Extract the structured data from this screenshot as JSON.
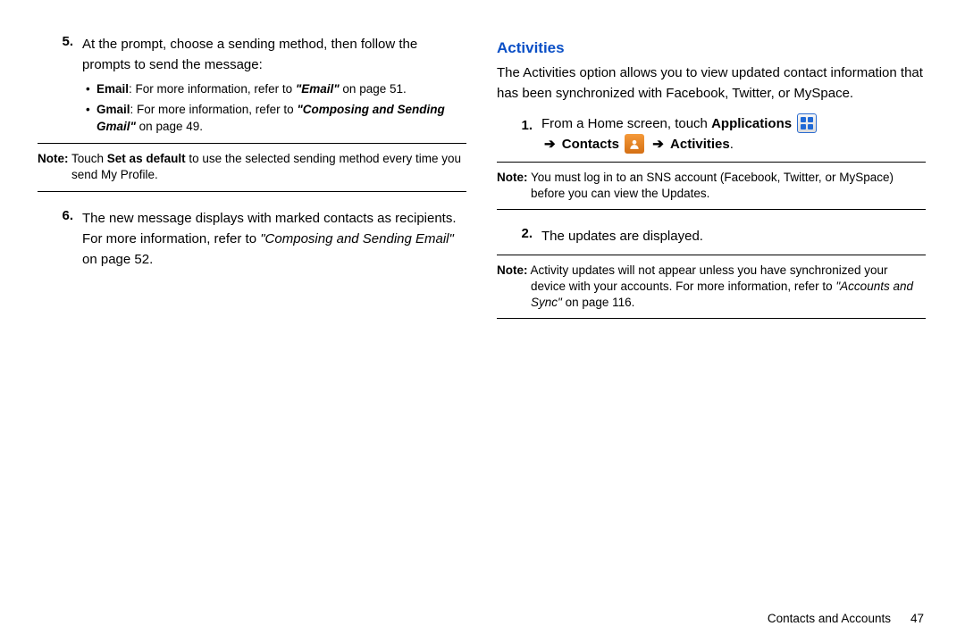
{
  "left": {
    "step5": {
      "num": "5.",
      "text": "At the prompt, choose a sending method, then follow the prompts to send the message:"
    },
    "bullets": {
      "email": {
        "label": "Email",
        "rest": ": For more information, refer to ",
        "ref": "\"Email\"",
        "tail": " on page 51."
      },
      "gmail": {
        "label": "Gmail",
        "rest": ": For more information, refer to ",
        "ref": "\"Composing and Sending Gmail\"",
        "tail": " on page 49."
      }
    },
    "note1": {
      "label": "Note:",
      "a": " Touch ",
      "b": "Set as default",
      "c": " to use the selected sending method every time you",
      "d": "send My Profile."
    },
    "step6": {
      "num": "6.",
      "a": "The new message displays with marked contacts as recipients. For more information, refer to ",
      "ref": "\"Composing and Sending Email\"",
      "tail": " on page 52."
    }
  },
  "right": {
    "heading": "Activities",
    "intro": "The Activities option allows you to view updated contact information that has been synchronized with Facebook, Twitter, or MySpace.",
    "step1": {
      "num": "1.",
      "a": "From a Home screen, touch ",
      "apps": "Applications",
      "arrow1": "➔",
      "contacts": "Contacts",
      "arrow2": "➔",
      "activities": "Activities",
      "dot": "."
    },
    "note2": {
      "label": "Note:",
      "a": " You must log in to an SNS account (Facebook, Twitter, or MySpace)",
      "b": "before you can view the Updates."
    },
    "step2": {
      "num": "2.",
      "text": "The updates are displayed."
    },
    "note3": {
      "label": "Note:",
      "a": " Activity updates will not appear unless you have synchronized your",
      "b": "device with your accounts. For more information, refer to ",
      "ref": "\"Accounts and Sync\"",
      "tail": " on page 116."
    }
  },
  "footer": {
    "section": "Contacts and Accounts",
    "page": "47"
  }
}
